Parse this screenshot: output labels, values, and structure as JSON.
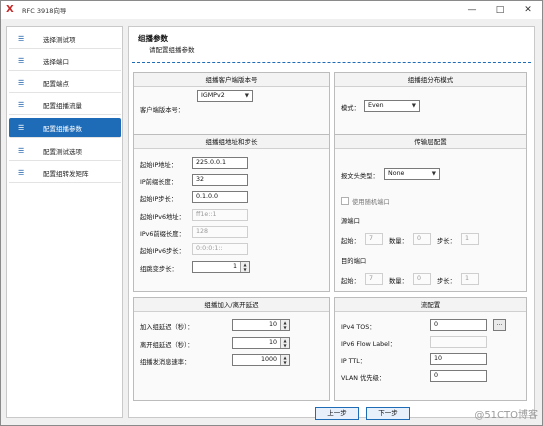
{
  "window": {
    "title": "RFC 3918向导",
    "logo": "X"
  },
  "sidebar": {
    "items": [
      {
        "label": "选择测试项",
        "icon": "list-icon",
        "active": false
      },
      {
        "label": "选择端口",
        "icon": "list-icon",
        "active": false
      },
      {
        "label": "配置端点",
        "icon": "list-icon",
        "active": false
      },
      {
        "label": "配置组播流量",
        "icon": "list-icon",
        "active": false
      },
      {
        "label": "配置组播参数",
        "icon": "list-icon",
        "active": true
      },
      {
        "label": "配置测试选项",
        "icon": "list-icon",
        "active": false
      },
      {
        "label": "配置组转发矩阵",
        "icon": "list-icon",
        "active": false
      }
    ]
  },
  "header": {
    "title": "组播参数",
    "subtitle": "请配置组播参数"
  },
  "client_version": {
    "panel_title": "组播客户端版本号",
    "label": "客户端版本号：",
    "value": "IGMPv2"
  },
  "group_dist": {
    "panel_title": "组播组分布模式",
    "label": "模式：",
    "value": "Even"
  },
  "group_addr": {
    "panel_title": "组播组地址和步长",
    "start_ip_label": "起始IP地址：",
    "start_ip": "225.0.0.1",
    "prefix_label": "IP前缀长度：",
    "prefix": "32",
    "ip_step_label": "起始IP步长：",
    "ip_step": "0.1.0.0",
    "ipv6_label": "起始IPv6地址：",
    "ipv6": "ff1e::1",
    "ipv6_prefix_label": "IPv6前缀长度：",
    "ipv6_prefix": "128",
    "ipv6_step_label": "起始IPv6步长：",
    "ipv6_step": "0:0:0:1::",
    "incr_label": "组跳变步长：",
    "incr": "1"
  },
  "transport": {
    "panel_title": "传输层配置",
    "header_type_label": "报文头类型：",
    "header_type": "None",
    "random_port_label": "使用随机端口",
    "src_port_label": "源端口",
    "dst_port_label": "目的端口",
    "start_label": "起始：",
    "count_label": "数量：",
    "step_label": "步长：",
    "src": {
      "start": "7",
      "count": "0",
      "step": "1"
    },
    "dst": {
      "start": "7",
      "count": "0",
      "step": "1"
    }
  },
  "join_leave": {
    "panel_title": "组播加入/离开延迟",
    "join_label": "加入组延迟（秒）：",
    "join": "10",
    "leave_label": "离开组延迟（秒）：",
    "leave": "10",
    "rate_label": "组播发消息速率：",
    "rate": "1000"
  },
  "stream": {
    "panel_title": "流配置",
    "tos_label": "IPv4 TOS：",
    "tos": "0",
    "tos_button": "...",
    "flow_label": "IPv6 Flow Label：",
    "flow": "",
    "ttl_label": "IP TTL：",
    "ttl": "10",
    "vlan_label": "VLAN 优先级：",
    "vlan": "0"
  },
  "footer": {
    "prev": "上一步",
    "next": "下一步"
  },
  "watermark": "@51CTO博客",
  "colors": {
    "accent": "#1e6cb8"
  }
}
